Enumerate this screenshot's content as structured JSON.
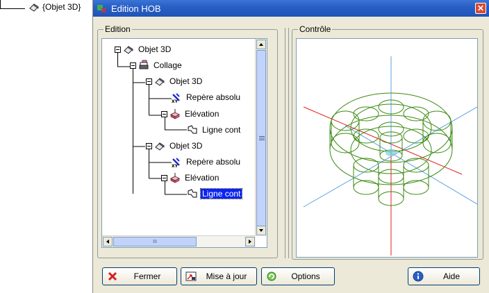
{
  "background_tree": {
    "node_label": "{Objet 3D}"
  },
  "window": {
    "title": "Edition HOB",
    "close_label": "✕"
  },
  "edition_panel": {
    "label": "Edition",
    "tree": [
      {
        "label": "Objet 3D",
        "icon": "shape-3d-icon"
      },
      {
        "label": "Collage",
        "icon": "stapler-icon"
      },
      {
        "label": "Objet 3D",
        "icon": "shape-3d-icon"
      },
      {
        "label": "Repère absolu",
        "icon": "xy-axis-icon"
      },
      {
        "label": "Elévation",
        "icon": "elevation-icon"
      },
      {
        "label": "Ligne cont",
        "icon": "contour-line-icon"
      },
      {
        "label": "Objet 3D",
        "icon": "shape-3d-icon"
      },
      {
        "label": "Repère absolu",
        "icon": "xy-axis-icon"
      },
      {
        "label": "Elévation",
        "icon": "elevation-icon"
      },
      {
        "label": "Ligne cont",
        "icon": "contour-line-icon",
        "selected": true
      }
    ],
    "hscroll_thumb_label": "III"
  },
  "control_panel": {
    "label": "Contrôle"
  },
  "buttons": {
    "close": "Fermer",
    "update": "Mise à jour",
    "options": "Options",
    "help": "Aide"
  },
  "colors": {
    "title_bar": "#2a5fc6",
    "selection": "#0a24f4",
    "axis_red": "#e02020",
    "axis_blue": "#5aa0e0",
    "gear_green": "#3a8a10"
  }
}
